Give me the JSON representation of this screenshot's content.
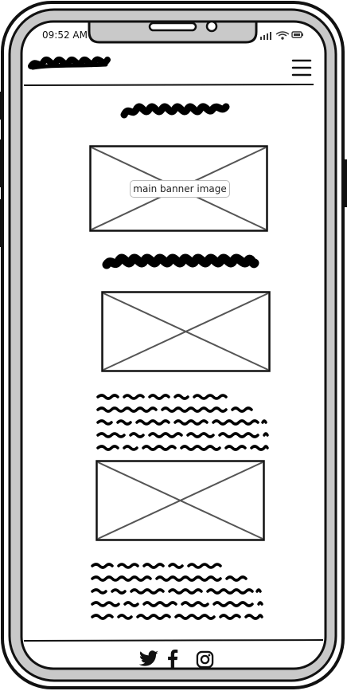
{
  "status_bar": {
    "time": "09:52 AM",
    "icons": [
      "signal-icon",
      "wifi-icon",
      "battery-icon"
    ]
  },
  "header": {
    "logo": "scribble-logo",
    "menu_icon": "hamburger-menu-icon"
  },
  "main": {
    "title": "scribble-heading",
    "banner": {
      "label": "main banner image"
    },
    "section_heading": "scribble-subheading",
    "images": [
      "image-placeholder-1",
      "image-placeholder-2"
    ],
    "paragraphs": [
      "scribble-text-block-1",
      "scribble-text-block-2"
    ]
  },
  "footer": {
    "icons": [
      "twitter-icon",
      "facebook-icon",
      "instagram-icon"
    ]
  }
}
